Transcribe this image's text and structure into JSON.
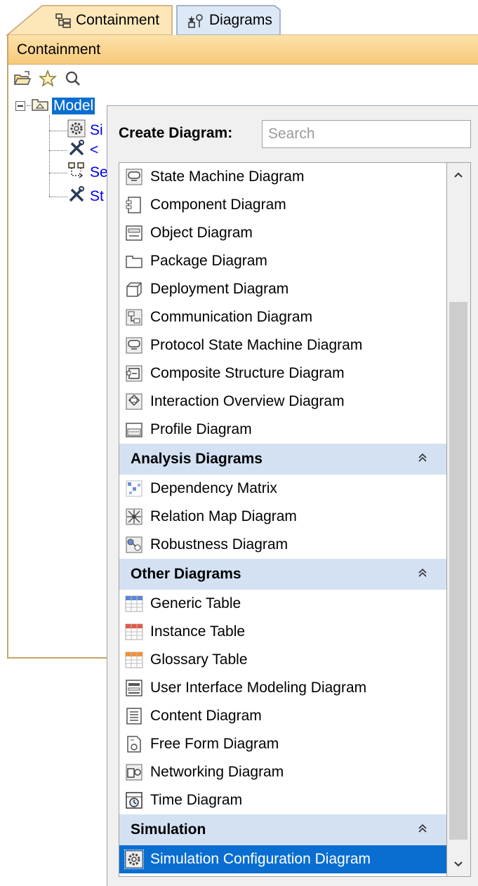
{
  "tabs": [
    {
      "label": "Containment",
      "icon": "containment-tree-icon",
      "active": true
    },
    {
      "label": "Diagrams",
      "icon": "diagrams-icon",
      "active": false
    }
  ],
  "panel": {
    "title": "Containment",
    "toolbar": [
      "open-folder-icon",
      "star-icon",
      "search-icon"
    ]
  },
  "tree": {
    "root": {
      "label": "Model",
      "icon": "package-icon"
    },
    "children": [
      {
        "label": "Si",
        "icon": "gear-icon"
      },
      {
        "label": "<",
        "icon": "tools-icon"
      },
      {
        "label": "Se",
        "icon": "structure-icon"
      },
      {
        "label": "St",
        "icon": "tools-icon"
      }
    ]
  },
  "popup": {
    "create_label": "Create Diagram:",
    "search_placeholder": "Search",
    "rows": [
      {
        "kind": "item",
        "label": "State Machine Diagram",
        "icon": "state-machine-icon"
      },
      {
        "kind": "item",
        "label": "Component Diagram",
        "icon": "component-icon"
      },
      {
        "kind": "item",
        "label": "Object Diagram",
        "icon": "object-icon"
      },
      {
        "kind": "item",
        "label": "Package Diagram",
        "icon": "package-icon"
      },
      {
        "kind": "item",
        "label": "Deployment Diagram",
        "icon": "deployment-icon"
      },
      {
        "kind": "item",
        "label": "Communication Diagram",
        "icon": "communication-icon"
      },
      {
        "kind": "item",
        "label": "Protocol State Machine Diagram",
        "icon": "protocol-state-machine-icon"
      },
      {
        "kind": "item",
        "label": "Composite Structure Diagram",
        "icon": "composite-structure-icon"
      },
      {
        "kind": "item",
        "label": "Interaction Overview Diagram",
        "icon": "interaction-overview-icon"
      },
      {
        "kind": "item",
        "label": "Profile Diagram",
        "icon": "profile-icon"
      },
      {
        "kind": "group",
        "label": "Analysis Diagrams"
      },
      {
        "kind": "item",
        "label": "Dependency Matrix",
        "icon": "dependency-matrix-icon"
      },
      {
        "kind": "item",
        "label": "Relation Map Diagram",
        "icon": "relation-map-icon"
      },
      {
        "kind": "item",
        "label": "Robustness Diagram",
        "icon": "robustness-icon"
      },
      {
        "kind": "group",
        "label": "Other Diagrams"
      },
      {
        "kind": "item",
        "label": "Generic Table",
        "icon": "generic-table-icon"
      },
      {
        "kind": "item",
        "label": "Instance Table",
        "icon": "instance-table-icon"
      },
      {
        "kind": "item",
        "label": "Glossary Table",
        "icon": "glossary-table-icon"
      },
      {
        "kind": "item",
        "label": "User Interface Modeling Diagram",
        "icon": "ui-modeling-icon"
      },
      {
        "kind": "item",
        "label": "Content Diagram",
        "icon": "content-icon"
      },
      {
        "kind": "item",
        "label": "Free Form Diagram",
        "icon": "free-form-icon"
      },
      {
        "kind": "item",
        "label": "Networking Diagram",
        "icon": "networking-icon"
      },
      {
        "kind": "item",
        "label": "Time Diagram",
        "icon": "time-icon"
      },
      {
        "kind": "group",
        "label": "Simulation"
      },
      {
        "kind": "item",
        "label": "Simulation Configuration Diagram",
        "icon": "gear-icon",
        "selected": true
      }
    ]
  },
  "colors": {
    "panel_header": "#f7c97a",
    "group_bg": "#d3e1f3",
    "selected_bg": "#0a6ed1",
    "tree_link": "#0000ee"
  }
}
